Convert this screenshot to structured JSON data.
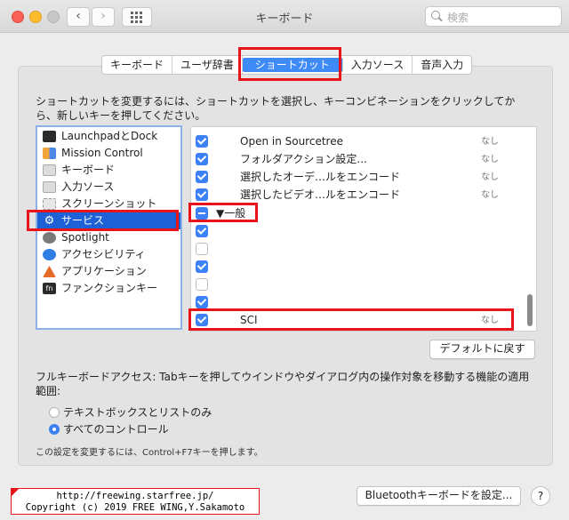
{
  "window": {
    "title": "キーボード",
    "search_placeholder": "検索"
  },
  "tabs": [
    "キーボード",
    "ユーザ辞書",
    "ショートカット",
    "入力ソース",
    "音声入力"
  ],
  "description": "ショートカットを変更するには、ショートカットを選択し、キーコンビネーションをクリックしてから、新しいキーを押してください。",
  "categories": [
    {
      "label": "LaunchpadとDock",
      "icon": "launchpad-icon"
    },
    {
      "label": "Mission Control",
      "icon": "mission-control-icon"
    },
    {
      "label": "キーボード",
      "icon": "keyboard-icon"
    },
    {
      "label": "入力ソース",
      "icon": "input-source-icon"
    },
    {
      "label": "スクリーンショット",
      "icon": "screenshot-icon"
    },
    {
      "label": "サービス",
      "icon": "gear-icon"
    },
    {
      "label": "Spotlight",
      "icon": "spotlight-icon"
    },
    {
      "label": "アクセシビリティ",
      "icon": "accessibility-icon"
    },
    {
      "label": "アプリケーション",
      "icon": "app-icon"
    },
    {
      "label": "ファンクションキー",
      "icon": "fn-icon"
    }
  ],
  "shortcuts": [
    {
      "name": "Open in Sourcetree",
      "key": "なし"
    },
    {
      "name": "フォルダアクション設定...",
      "key": "なし"
    },
    {
      "name": "選択したオーデ…ルをエンコード",
      "key": "なし"
    },
    {
      "name": "選択したビデオ…ルをエンコード",
      "key": "なし"
    },
    {
      "group": "▼一般"
    },
    {
      "name": "",
      "key": ""
    },
    {
      "name": "",
      "key": ""
    },
    {
      "name": "",
      "key": ""
    },
    {
      "name": "",
      "key": ""
    },
    {
      "name": "",
      "key": ""
    },
    {
      "name": "SCI",
      "key": "なし"
    }
  ],
  "restore_default": "デフォルトに戻す",
  "full_keyboard_access": {
    "label": "フルキーボードアクセス: Tabキーを押してウインドウやダイアログ内の操作対象を移動する機能の適用範囲:",
    "options": [
      "テキストボックスとリストのみ",
      "すべてのコントロール"
    ],
    "note": "この設定を変更するには、Control+F7キーを押します。"
  },
  "bluetooth_button": "Bluetoothキーボードを設定...",
  "help": "?",
  "credit": [
    "http://freewing.starfree.jp/",
    "Copyright (c) 2019 FREE WING,Y.Sakamoto"
  ]
}
